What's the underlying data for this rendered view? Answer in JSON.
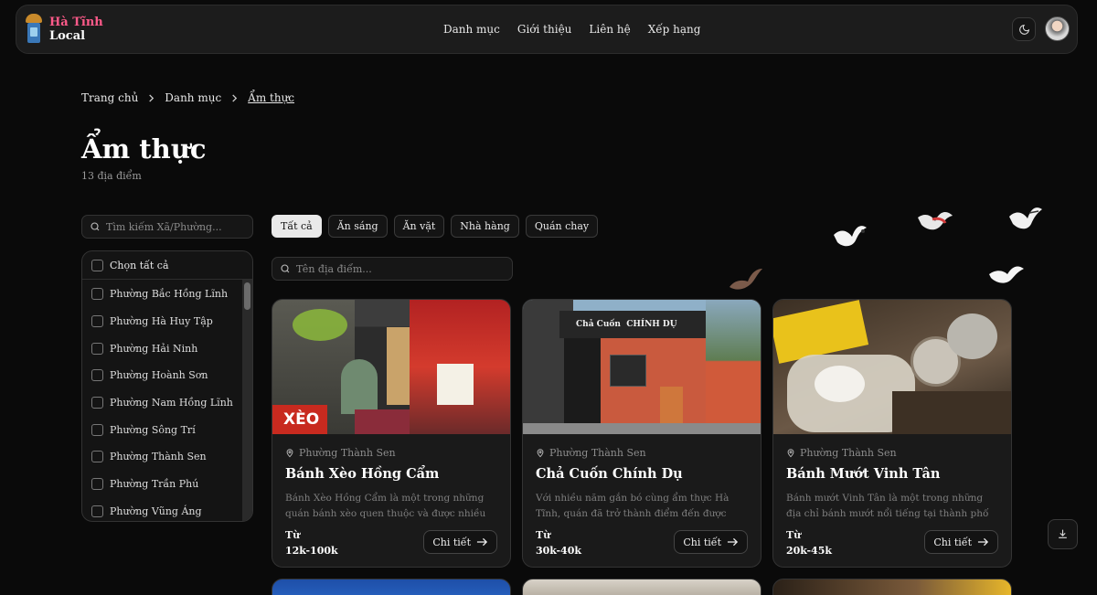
{
  "header": {
    "logo_line1": "Hà Tĩnh",
    "logo_line2": "Local",
    "nav": [
      "Danh mục",
      "Giới thiệu",
      "Liên hệ",
      "Xếp hạng"
    ]
  },
  "breadcrumb": [
    "Trang chủ",
    "Danh mục",
    "Ẩm thực"
  ],
  "page": {
    "title": "Ẩm thực",
    "count": "13 địa điểm"
  },
  "sidebar": {
    "search_placeholder": "Tìm kiếm Xã/Phường...",
    "select_all": "Chọn tất cả",
    "wards": [
      "Phường Bắc Hồng Lĩnh",
      "Phường Hà Huy Tập",
      "Phường Hải Ninh",
      "Phường Hoành Sơn",
      "Phường Nam Hồng Lĩnh",
      "Phường Sông Trí",
      "Phường Thành Sen",
      "Phường Trần Phú",
      "Phường Vũng Áng"
    ]
  },
  "filters": [
    "Tất cả",
    "Ăn sáng",
    "Ăn vặt",
    "Nhà hàng",
    "Quán chay"
  ],
  "place_search_placeholder": "Tên địa điểm...",
  "cards": [
    {
      "ward": "Phường Thành Sen",
      "title": "Bánh Xèo Hồng Cẩm",
      "desc": "Bánh Xèo Hồng Cẩm là một trong những quán bánh xèo quen thuộc và được nhiều người yêu...",
      "price_label": "Từ",
      "price": "12k-100k",
      "button": "Chi tiết",
      "sign_text": "XÈO"
    },
    {
      "ward": "Phường Thành Sen",
      "title": "Chả Cuốn Chính Dụ",
      "desc": "Với nhiều năm gắn bó cùng ẩm thực Hà Tĩnh, quán đã trở thành điểm đến được người dân và...",
      "price_label": "Từ",
      "price": "30k-40k",
      "button": "Chi tiết",
      "sign_text": "Chả Cuốn  CHÍNH DỤ"
    },
    {
      "ward": "Phường Thành Sen",
      "title": "Bánh Mướt Vinh Tân",
      "desc": "Bánh mướt Vinh Tân là một trong những địa chỉ bánh mướt nổi tiếng tại thành phố Hà Tĩnh, đư...",
      "price_label": "Từ",
      "price": "20k-45k",
      "button": "Chi tiết"
    }
  ],
  "colors": {
    "background": "#0a0a0a",
    "accent_logo": "#ff5a8a"
  }
}
